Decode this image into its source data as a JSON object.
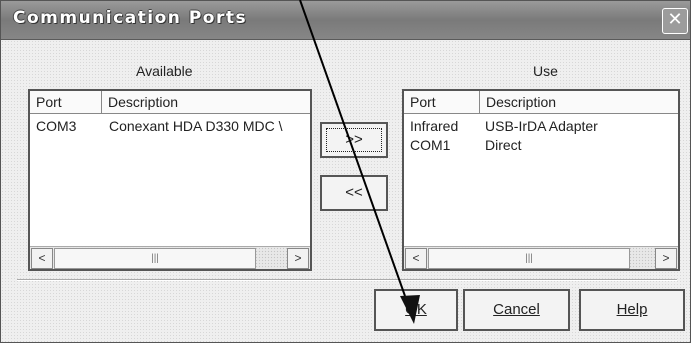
{
  "window": {
    "title": "Communication Ports",
    "close_icon": "✕"
  },
  "available": {
    "label": "Available",
    "columns": [
      "Port",
      "Description"
    ],
    "rows": [
      {
        "port": "COM3",
        "description": "Conexant HDA D330 MDC \\"
      }
    ]
  },
  "use": {
    "label": "Use",
    "columns": [
      "Port",
      "Description"
    ],
    "rows": [
      {
        "port": "Infrared",
        "description": "USB-IrDA Adapter"
      },
      {
        "port": "COM1",
        "description": "Direct"
      }
    ]
  },
  "transfer": {
    "add_label": ">>",
    "remove_label": "<<"
  },
  "footer": {
    "ok_label": "OK",
    "cancel_label": "Cancel",
    "help_label": "Help"
  },
  "scrollbar": {
    "left_arrow": "<",
    "right_arrow": ">",
    "thumb_grip": "|||"
  },
  "colors": {
    "titlebar": "#7a7a7a",
    "background": "#efefef",
    "annotation_line": "#000000"
  }
}
